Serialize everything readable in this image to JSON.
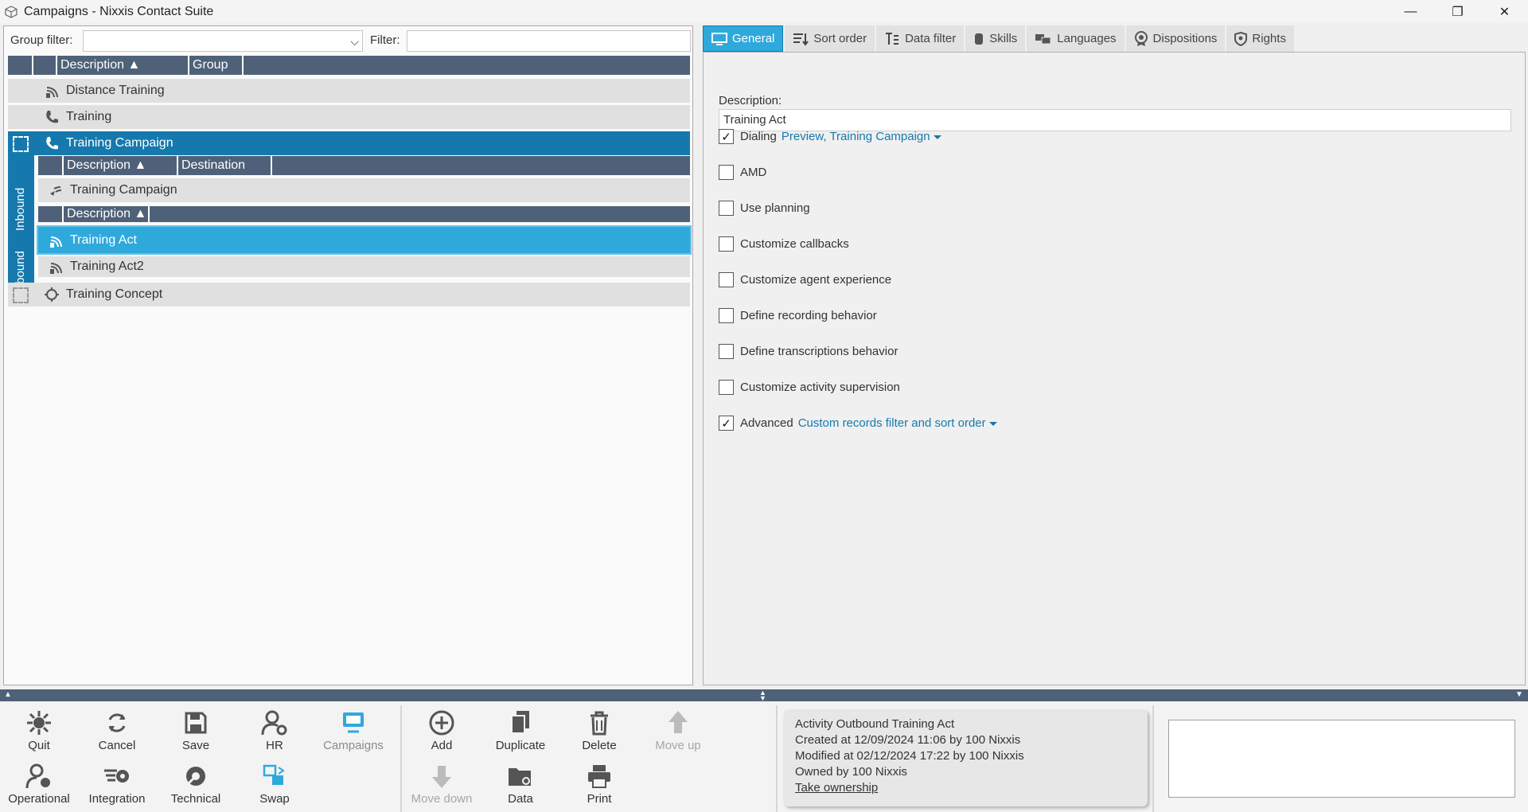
{
  "window": {
    "title": "Campaigns - Nixxis Contact Suite",
    "minimize": "—",
    "restore": "❐",
    "close": "✕"
  },
  "filters": {
    "group_label": "Group filter:",
    "filter_label": "Filter:",
    "group_value": "",
    "filter_value": ""
  },
  "grid": {
    "headers": [
      "Description ▲",
      "Group"
    ],
    "rows": [
      "Distance Training",
      "Training",
      "Training Campaign",
      "Training Concept"
    ],
    "sidetabs": {
      "inbound": "Inbound",
      "outbound": "Outbound"
    },
    "inbound_headers": [
      "Description ▲",
      "Destination"
    ],
    "inbound_rows": [
      "Training Campaign"
    ],
    "outbound_headers": [
      "Description ▲"
    ],
    "outbound_rows": [
      "Training Act",
      "Training Act2"
    ]
  },
  "tabs": [
    "General",
    "Sort order",
    "Data filter",
    "Skills",
    "Languages",
    "Dispositions",
    "Rights"
  ],
  "general": {
    "description_label": "Description:",
    "description_value": "Training Act",
    "options": [
      {
        "label": "Dialing",
        "checked": true,
        "link": "Preview, Training Campaign"
      },
      {
        "label": "AMD",
        "checked": false,
        "link": ""
      },
      {
        "label": "Use planning",
        "checked": false,
        "link": ""
      },
      {
        "label": "Customize callbacks",
        "checked": false,
        "link": ""
      },
      {
        "label": "Customize agent experience",
        "checked": false,
        "link": ""
      },
      {
        "label": "Define recording behavior",
        "checked": false,
        "link": ""
      },
      {
        "label": "Define transcriptions behavior",
        "checked": false,
        "link": ""
      },
      {
        "label": "Customize activity supervision",
        "checked": false,
        "link": ""
      },
      {
        "label": "Advanced",
        "checked": true,
        "link": "Custom records filter and sort order"
      }
    ]
  },
  "toolbar": {
    "quit": "Quit",
    "cancel": "Cancel",
    "save": "Save",
    "hr": "HR",
    "campaigns": "Campaigns",
    "operational": "Operational",
    "integration": "Integration",
    "technical": "Technical",
    "swap": "Swap",
    "add": "Add",
    "duplicate": "Duplicate",
    "delete": "Delete",
    "move_up": "Move up",
    "move_down": "Move down",
    "data": "Data",
    "print": "Print"
  },
  "info": {
    "line1": "Activity Outbound Training Act",
    "line2": "Created at 12/09/2024 11:06 by 100 Nixxis",
    "line3": "Modified at 02/12/2024 17:22 by 100 Nixxis",
    "line4": "Owned by 100 Nixxis",
    "ownership": "Take ownership"
  },
  "colors": {
    "accent": "#2fa9dc",
    "selected": "#1679ad",
    "header": "#4e6178"
  }
}
